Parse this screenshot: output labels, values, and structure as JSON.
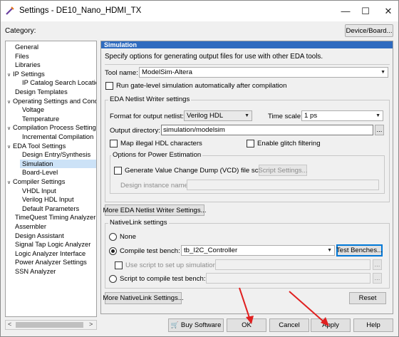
{
  "window": {
    "title": "Settings - DE10_Nano_HDMI_TX",
    "minimize_glyph": "—",
    "maximize_glyph": "☐",
    "close_glyph": "✕"
  },
  "category_label": "Category:",
  "device_button": "Device/Board...",
  "tree": {
    "scroll_left": "<",
    "scroll_right": ">",
    "items": [
      {
        "label": "General",
        "indent": 0,
        "caret": ""
      },
      {
        "label": "Files",
        "indent": 0,
        "caret": ""
      },
      {
        "label": "Libraries",
        "indent": 0,
        "caret": ""
      },
      {
        "label": "IP Settings",
        "indent": 0,
        "caret": "∨"
      },
      {
        "label": "IP Catalog Search Locations",
        "indent": 2,
        "caret": ""
      },
      {
        "label": "Design Templates",
        "indent": 0,
        "caret": ""
      },
      {
        "label": "Operating Settings and Conditions",
        "indent": 0,
        "caret": "∨"
      },
      {
        "label": "Voltage",
        "indent": 2,
        "caret": ""
      },
      {
        "label": "Temperature",
        "indent": 2,
        "caret": ""
      },
      {
        "label": "Compilation Process Settings",
        "indent": 0,
        "caret": "∨"
      },
      {
        "label": "Incremental Compilation",
        "indent": 2,
        "caret": ""
      },
      {
        "label": "EDA Tool Settings",
        "indent": 0,
        "caret": "∨"
      },
      {
        "label": "Design Entry/Synthesis",
        "indent": 2,
        "caret": ""
      },
      {
        "label": "Simulation",
        "indent": 2,
        "caret": "",
        "selected": true
      },
      {
        "label": "Board-Level",
        "indent": 2,
        "caret": ""
      },
      {
        "label": "Compiler Settings",
        "indent": 0,
        "caret": "∨"
      },
      {
        "label": "VHDL Input",
        "indent": 2,
        "caret": ""
      },
      {
        "label": "Verilog HDL Input",
        "indent": 2,
        "caret": ""
      },
      {
        "label": "Default Parameters",
        "indent": 2,
        "caret": ""
      },
      {
        "label": "TimeQuest Timing Analyzer",
        "indent": 0,
        "caret": ""
      },
      {
        "label": "Assembler",
        "indent": 0,
        "caret": ""
      },
      {
        "label": "Design Assistant",
        "indent": 0,
        "caret": ""
      },
      {
        "label": "Signal Tap Logic Analyzer",
        "indent": 0,
        "caret": ""
      },
      {
        "label": "Logic Analyzer Interface",
        "indent": 0,
        "caret": ""
      },
      {
        "label": "Power Analyzer Settings",
        "indent": 0,
        "caret": ""
      },
      {
        "label": "SSN Analyzer",
        "indent": 0,
        "caret": ""
      }
    ]
  },
  "panel": {
    "header": "Simulation",
    "description": "Specify options for generating output files for use with other EDA tools.",
    "tool_name_label": "Tool name:",
    "tool_name_value": "ModelSim-Altera",
    "run_gate_level_label": "Run gate-level simulation automatically after compilation",
    "eda_group_title": "EDA Netlist Writer settings",
    "format_label": "Format for output netlist:",
    "format_value": "Verilog HDL",
    "time_scale_label": "Time scale:",
    "time_scale_value": "1 ps",
    "output_dir_label": "Output directory:",
    "output_dir_value": "simulation/modelsim",
    "browse_glyph": "...",
    "map_illegal_label": "Map illegal HDL characters",
    "glitch_label": "Enable glitch filtering",
    "power_group_title": "Options for Power Estimation",
    "vcd_label": "Generate Value Change Dump (VCD) file script",
    "script_settings_button": "Script Settings...",
    "design_instance_label": "Design instance name:",
    "design_instance_value": "",
    "more_eda_button": "More EDA Netlist Writer Settings...",
    "nativelink_group_title": "NativeLink settings",
    "none_label": "None",
    "compile_tb_label": "Compile test bench:",
    "compile_tb_value": "tb_I2C_Controller",
    "test_benches_button": "Test Benches...",
    "use_script_label": "Use script to set up simulation:",
    "script_compile_label": "Script to compile test bench:",
    "more_nativelink_button": "More NativeLink Settings...",
    "reset_button": "Reset"
  },
  "footer": {
    "buy_software": "Buy Software",
    "ok": "OK",
    "cancel": "Cancel",
    "apply": "Apply",
    "help": "Help"
  },
  "colors": {
    "header_blue": "#2f6bbf",
    "selection": "#cce2f7",
    "annotation_red": "#e02020",
    "focus_blue": "#0078d7"
  }
}
